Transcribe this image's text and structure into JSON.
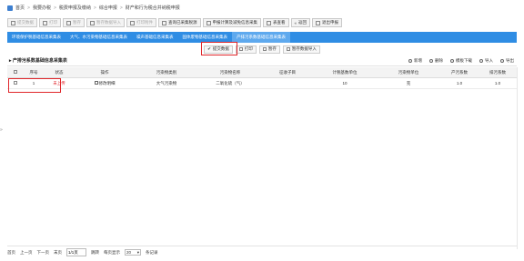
{
  "breadcrumb": [
    "首页",
    "我要办税",
    "税费申报及缴纳",
    "综合申报",
    "财产和行为税合并纳税申报"
  ],
  "toolbar": [
    {
      "label": "提交数据",
      "disabled": true
    },
    {
      "label": "打印",
      "disabled": true
    },
    {
      "label": "暂存",
      "disabled": true
    },
    {
      "label": "暂存数据导入",
      "disabled": true
    },
    {
      "label": "打印附件",
      "disabled": true
    },
    {
      "label": "查询已采集税源",
      "disabled": false
    },
    {
      "label": "申报计算及减免信息采集",
      "disabled": false
    },
    {
      "label": "表查看",
      "disabled": false
    },
    {
      "label": "返回",
      "disabled": false
    },
    {
      "label": "退出申报",
      "disabled": false
    }
  ],
  "tabs": [
    "环境保护税基础信息采集表",
    "大气、水污染物基础信息采集表",
    "噪声基础信息采集表",
    "固体废物基础信息采集表",
    "产排污系数基础信息采集表"
  ],
  "active_tab": 4,
  "subbar": [
    "提交数据",
    "打印",
    "暂存",
    "暂存数据导入"
  ],
  "section": {
    "title": "产排污系数基础信息采集表",
    "actions": [
      "新增",
      "删除",
      "模板下载",
      "导入",
      "导出"
    ]
  },
  "table": {
    "headers": [
      "",
      "序号",
      "状态",
      "操作",
      "污染物类别",
      "污染物名称",
      "征收子目",
      "计税基数单位",
      "污染物单位",
      "产污系数",
      "排污系数"
    ],
    "rows": [
      {
        "seq": "1",
        "status": "未上传",
        "op": "修改明细",
        "category": "大气污染物",
        "name": "二氧化硫（气）",
        "subitem": "",
        "base_unit": "10",
        "unit": "克",
        "prod_coef": "1.0",
        "emit_coef": "1.0"
      }
    ]
  },
  "pager": {
    "first": "首页",
    "prev": "上一页",
    "next": "下一页",
    "last": "末页",
    "page_value": "1/1页",
    "jump": "跳转",
    "per_page_label": "每页显示",
    "per_page": "20",
    "records": "条记录"
  },
  "colors": {
    "accent": "#2f8de4",
    "active_tab": "#5ea9ee",
    "highlight": "#e0262b"
  }
}
